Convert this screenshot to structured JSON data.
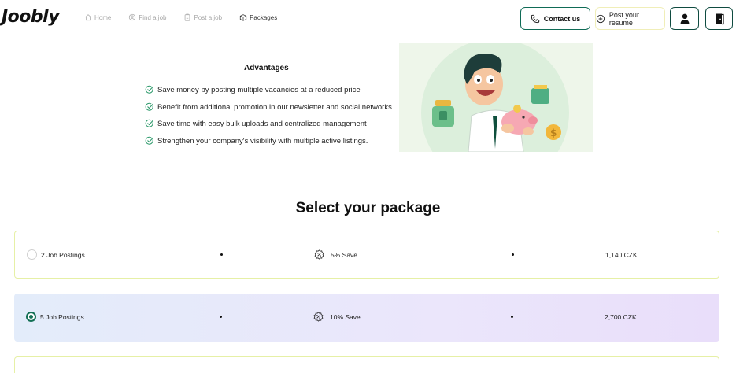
{
  "header": {
    "logo": "Joobly",
    "nav": [
      {
        "label": "Home",
        "icon": "home-icon"
      },
      {
        "label": "Find a job",
        "icon": "search-person-icon"
      },
      {
        "label": "Post a job",
        "icon": "clipboard-icon"
      },
      {
        "label": "Packages",
        "icon": "package-icon"
      }
    ],
    "contact_label": "Contact us",
    "resume_label": "Post your resume"
  },
  "advantages": {
    "title": "Advantages",
    "items": [
      "Save money by posting multiple vacancies at a reduced price",
      "Benefit from additional promotion in our newsletter and social networks",
      "Save time with easy bulk uploads and centralized management",
      "Strengthen your company's visibility with multiple active listings."
    ]
  },
  "packages": {
    "title": "Select your package",
    "options": [
      {
        "name": "2 Job Postings",
        "save": "5% Save",
        "price": "1,140 CZK",
        "selected": false
      },
      {
        "name": "5 Job Postings",
        "save": "10% Save",
        "price": "2,700 CZK",
        "selected": true
      }
    ]
  },
  "colors": {
    "accent": "#147055",
    "check": "#2e9a6c",
    "card_border": "#e6f0a6"
  }
}
